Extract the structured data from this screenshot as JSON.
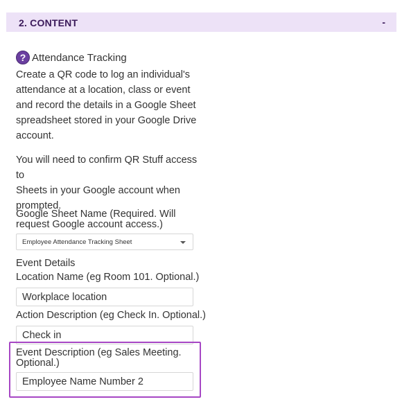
{
  "section": {
    "title": "2. CONTENT",
    "toggle": "-"
  },
  "tool": {
    "icon": "question-circle-icon",
    "title": "Attendance Tracking",
    "description_lines": [
      "Create a QR code to log an individual's",
      "attendance at a location, class or event",
      "and record the details in a Google Sheet",
      "spreadsheet stored in your Google Drive",
      "account."
    ],
    "notice_lines": [
      "You will need to confirm QR Stuff access to",
      "Sheets in your Google account when",
      "prompted."
    ]
  },
  "form": {
    "sheet_name_label_1": "Google Sheet Name (Required. Will",
    "sheet_name_label_2": "request Google account access.)",
    "sheet_name_value": "Employee Attendance Tracking Sheet",
    "event_details_heading": "Event Details",
    "location_label": "Location Name (eg Room 101. Optional.)",
    "location_value": "Workplace location",
    "action_label": "Action Description (eg Check In. Optional.)",
    "action_value": "Check in",
    "event_desc_label_1": "Event Description (eg Sales Meeting.",
    "event_desc_label_2": "Optional.)",
    "event_desc_value": "Employee Name Number 2"
  },
  "colors": {
    "header_bg": "#ede2f7",
    "header_text": "#3b1a5a",
    "help_icon": "#6b3fa0",
    "highlight_border": "#a646c4"
  }
}
